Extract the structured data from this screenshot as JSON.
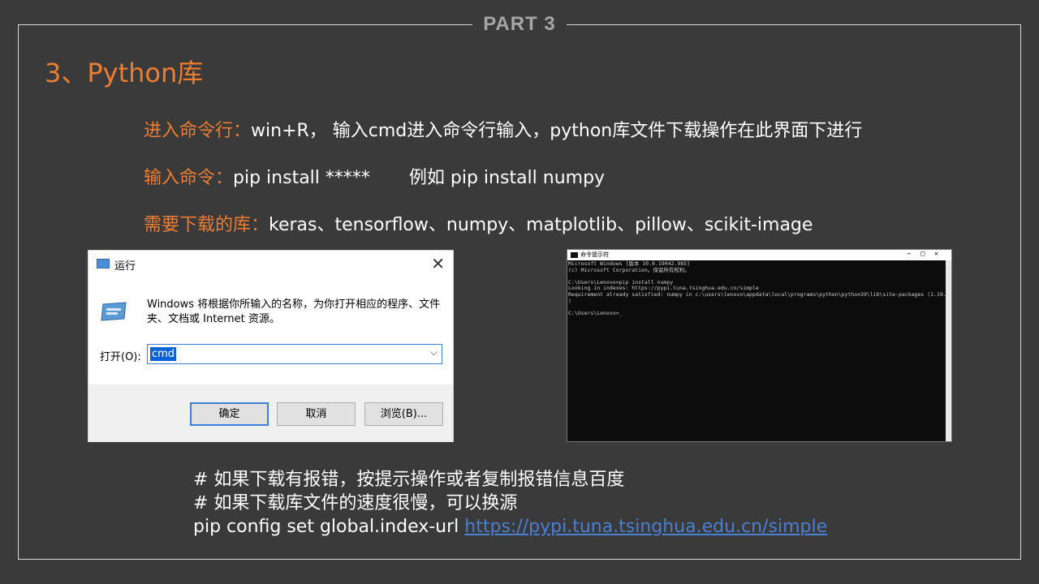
{
  "part_label": "PART 3",
  "section_title": "3、Python库",
  "lines": [
    {
      "key": "进入命令行：",
      "text": "win+R， 输入cmd进入命令行输入，python库文件下载操作在此界面下进行"
    },
    {
      "key": "输入命令：",
      "text": "pip install *****",
      "extra": "例如   pip install numpy"
    },
    {
      "key": "需要下载的库：",
      "text": "keras、tensorflow、numpy、matplotlib、pillow、scikit-image"
    }
  ],
  "run_dialog": {
    "title": "运行",
    "message": "Windows 将根据你所输入的名称，为你打开相应的程序、文件夹、文档或 Internet 资源。",
    "open_label": "打开(O):",
    "input_value": "cmd",
    "buttons": {
      "ok": "确定",
      "cancel": "取消",
      "browse": "浏览(B)..."
    }
  },
  "console": {
    "title": "命令提示符",
    "lines": [
      "Microsoft Windows [版本 10.0.19042.985]",
      "(c) Microsoft Corporation。保留所有权利。",
      "",
      "C:\\Users\\Lenovo>pip install numpy",
      "Looking in indexes: https://pypi.tuna.tsinghua.edu.cn/simple",
      "Requirement already satisfied: numpy in c:\\users\\lenovo\\appdata\\local\\programs\\python\\python39\\lib\\site-packages (1.19.5",
      ")",
      "",
      "C:\\Users\\Lenovo>_"
    ]
  },
  "notes": {
    "line1": "# 如果下载有报错，按提示操作或者复制报错信息百度",
    "line2": "# 如果下载库文件的速度很慢，可以换源",
    "line3_prefix": "pip config set global.index-url ",
    "line3_link": "https://pypi.tuna.tsinghua.edu.cn/simple"
  }
}
